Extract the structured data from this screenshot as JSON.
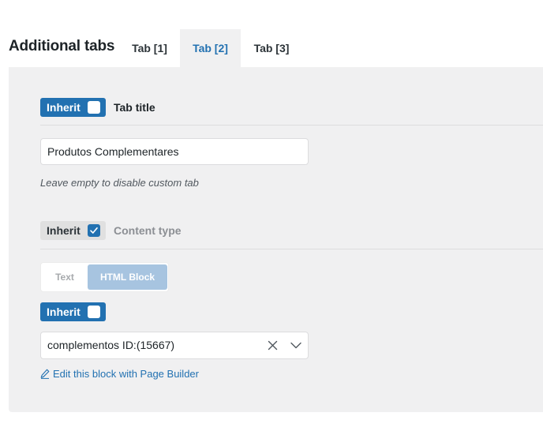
{
  "header": {
    "title": "Additional tabs",
    "tabs": [
      {
        "label": "Tab [1]",
        "active": false
      },
      {
        "label": "Tab [2]",
        "active": true
      },
      {
        "label": "Tab [3]",
        "active": false
      }
    ]
  },
  "tab_title": {
    "inherit_label": "Inherit",
    "inherit_checked": false,
    "label": "Tab title",
    "value": "Produtos Complementares",
    "hint": "Leave empty to disable custom tab"
  },
  "content_type": {
    "inherit_label": "Inherit",
    "inherit_checked": true,
    "label": "Content type",
    "options": [
      "Text",
      "HTML Block"
    ],
    "selected": "HTML Block"
  },
  "html_block": {
    "inherit_label": "Inherit",
    "inherit_checked": false,
    "value": "complementos ID:(15667)",
    "edit_link": "Edit this block with Page Builder"
  },
  "colors": {
    "accent": "#2271b1",
    "panel_bg": "#f0f0f1",
    "segment_active": "#a7c4e0"
  },
  "icons": [
    "checkbox-check-icon",
    "clear-icon",
    "chevron-down-icon",
    "pencil-icon"
  ]
}
